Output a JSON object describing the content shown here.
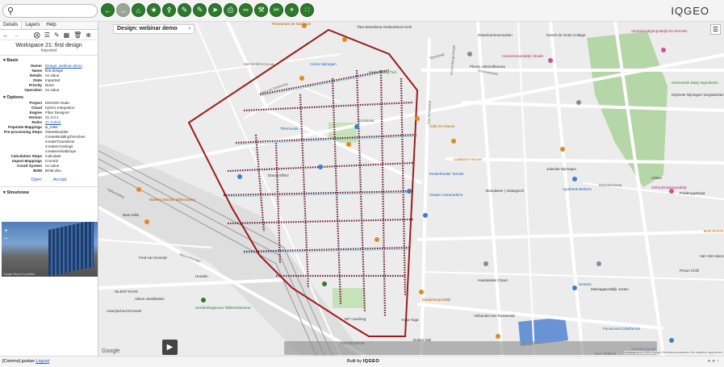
{
  "search": {
    "placeholder": ""
  },
  "toolbar": {
    "buttons": [
      "back-arrow-icon",
      "forward-arrow-icon",
      "home-icon",
      "star-icon",
      "tag-icon",
      "pencil-icon",
      "pencil-icon",
      "send-icon",
      "printer-icon",
      "route-icon",
      "tools-icon",
      "cut-icon",
      "network-icon",
      "share-icon"
    ]
  },
  "brand": {
    "logo_left": "IQ",
    "logo_right": "GEO"
  },
  "left_panel": {
    "tabs": [
      "Details",
      "Layers",
      "Help"
    ],
    "workspace_title": "Workspace 21: first design",
    "workspace_status": "Imported",
    "basic_label": "Basic",
    "basic": [
      {
        "k": "Owner",
        "v": "Design: webinar demo",
        "link": true
      },
      {
        "k": "Name",
        "v": "first design"
      },
      {
        "k": "Details",
        "v": "no value"
      },
      {
        "k": "State",
        "v": "Imported"
      },
      {
        "k": "Priority",
        "v": "None"
      },
      {
        "k": "Operation",
        "v": "no value"
      }
    ],
    "options_label": "Options",
    "options": [
      {
        "k": "Project",
        "v": "DESIGN Node"
      },
      {
        "k": "Cloud",
        "v": "IQGeo Integration"
      },
      {
        "k": "Engine",
        "v": "Fiber Designer"
      },
      {
        "k": "Version",
        "v": "21.2.0.1"
      },
      {
        "k": "Rules",
        "v": "21 (rules)",
        "link": true
      },
      {
        "k": "Populate Mappings",
        "v": "&_rules"
      },
      {
        "k": "Pre-processing Steps",
        "v": "/streetDoubler"
      },
      {
        "k": "",
        "v": "/createBuildingTrenches"
      },
      {
        "k": "",
        "v": "/createTransitions"
      },
      {
        "k": "",
        "v": "/createCrossings"
      },
      {
        "k": "",
        "v": "/createAerialDrops"
      },
      {
        "k": "Calculation Steps",
        "v": "/calculate"
      },
      {
        "k": "Import Mappings",
        "v": "Commit"
      },
      {
        "k": "Coord System",
        "v": "no value"
      },
      {
        "k": "BOM",
        "v": "BOM.xlsx"
      }
    ],
    "open_label": "Open",
    "accept_label": "Accept",
    "streetview_label": "Streetview",
    "streetview_caption": "Google   Report a problem"
  },
  "map": {
    "design_title": "Design: webinar demo",
    "google_label": "Google",
    "attribution": "Kaartgegevens ©2023 Google   Gebruiksvoorwaarden   Een kaartfout rapporteren",
    "labels": [
      {
        "t": "Restaurant de Stadstuin",
        "c": "orange"
      },
      {
        "t": "Titus Brandsma Gedachtenis Kerk",
        "c": ""
      },
      {
        "t": "Glasslcommunication",
        "c": ""
      },
      {
        "t": "Kanrel de Grote College",
        "c": ""
      },
      {
        "t": "Verloskundigenpraktijk De Wervels",
        "c": "pink"
      },
      {
        "t": "Huisartsenpraktijk Altrade",
        "c": "pink"
      },
      {
        "t": "Plexus Uitzendbureau",
        "c": ""
      },
      {
        "t": "Action Nijmegen",
        "c": "blue"
      },
      {
        "t": "Hoek Haring Tuin",
        "c": "green"
      },
      {
        "t": "Thermoods",
        "c": "blue"
      },
      {
        "t": "Cafe St Antonio",
        "c": "orange"
      },
      {
        "t": "Calafaria Famous",
        "c": "orange"
      },
      {
        "t": "Dance Effect",
        "c": ""
      },
      {
        "t": "Kinderthealer Tanzter",
        "c": "blue"
      },
      {
        "t": "Vesper Cameraderie",
        "c": "blue"
      },
      {
        "t": "Jukeoke Nijmegen",
        "c": ""
      },
      {
        "t": "Brandweer | strategisch",
        "c": ""
      },
      {
        "t": "Apotheek Berkers",
        "c": "blue"
      },
      {
        "t": "Artsen",
        "c": ""
      },
      {
        "t": "Orthodontistenpraktijk",
        "c": "pink"
      },
      {
        "t": "New India",
        "c": ""
      },
      {
        "t": "Bakkery Banket Willemsweg",
        "c": "orange"
      },
      {
        "t": "Fred van Doompt",
        "c": ""
      },
      {
        "t": "Honden",
        "c": ""
      },
      {
        "t": "SILENT RAVE",
        "c": ""
      },
      {
        "t": "Akkon vloeibleden",
        "c": ""
      },
      {
        "t": "Herdenkingsmuur Willemskazerne",
        "c": "green"
      },
      {
        "t": "Autorijschool M Kazel",
        "c": ""
      },
      {
        "t": "Tandartsenpraktijk",
        "c": "orange"
      },
      {
        "t": "Vishandel van Rosseveld",
        "c": ""
      },
      {
        "t": "Handwinkel Clown",
        "c": ""
      },
      {
        "t": "Yoga Yoga",
        "c": ""
      },
      {
        "t": "Dokter Noli",
        "c": ""
      },
      {
        "t": "Hertech",
        "c": "blue"
      },
      {
        "t": "Massagepraktijk Josien",
        "c": ""
      },
      {
        "t": "Functional Calisthenics",
        "c": "blue"
      },
      {
        "t": "Orange Garage",
        "c": "blue"
      },
      {
        "t": "M.S. Federel",
        "c": ""
      },
      {
        "t": "Greenmark Dairy Ingredients",
        "c": "green"
      },
      {
        "t": "Keijmeer Nijmegen Vergaderkamer",
        "c": ""
      },
      {
        "t": "Polsbrugsstraat",
        "c": ""
      },
      {
        "t": "BAR PASTA",
        "c": "orange"
      },
      {
        "t": "Van Viet Advocaten",
        "c": ""
      },
      {
        "t": "Prison Chilli",
        "c": ""
      },
      {
        "t": "EXCREAMINE",
        "c": ""
      },
      {
        "t": "DIT coaching",
        "c": ""
      }
    ],
    "streets": [
      "Grootstraat",
      "Spoorpad",
      "Van Welderenstraat",
      "Berg en Dalseweg",
      "Willemsweg",
      "Kronenburgersingel",
      "Bijleveldsingel",
      "Sint Annastraat",
      "Mauritiusstraat",
      "Groenestraat"
    ]
  },
  "status": {
    "user_prefix": "[Comms] gustav",
    "logout_label": "Logout",
    "built_by": "Built by",
    "built_brand": "IQGEO"
  }
}
